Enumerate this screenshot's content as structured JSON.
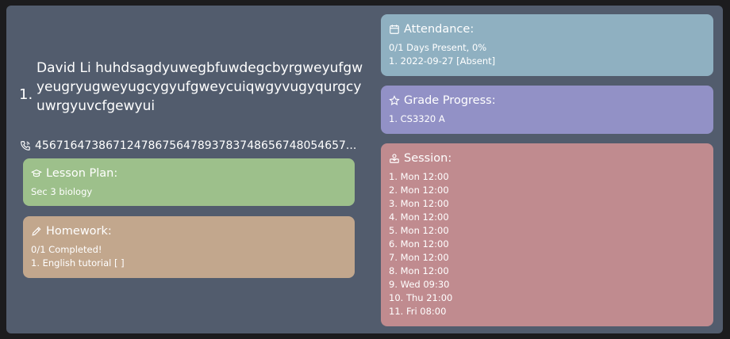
{
  "student": {
    "index": "1.",
    "name": "David Li huhdsagdyuwegbfuwdegcbyrgweyufgwyeugryugweyugcygyufgweycuiqwgyvugyqurgcyuwrgyuvcfgewyui",
    "phone": "45671647386712478675647893783748656748054657...",
    "phone_icon": "phone-icon"
  },
  "lesson_plan": {
    "title": "Lesson Plan:",
    "icon": "graduation-cap-icon",
    "lines": [
      "Sec 3 biology"
    ]
  },
  "homework": {
    "title": "Homework:",
    "icon": "pencil-icon",
    "lines": [
      "0/1 Completed!",
      "1. English tutorial [ ]"
    ]
  },
  "attendance": {
    "title": "Attendance:",
    "icon": "calendar-icon",
    "lines": [
      "0/1 Days Present, 0%",
      "1. 2022-09-27 [Absent]"
    ]
  },
  "grade_progress": {
    "title": "Grade Progress:",
    "icon": "star-icon",
    "lines": [
      "1. CS3320 A"
    ]
  },
  "session": {
    "title": "Session:",
    "icon": "teacher-icon",
    "lines": [
      "1. Mon 12:00",
      "2. Mon 12:00",
      "3. Mon 12:00",
      "4. Mon 12:00",
      "5. Mon 12:00",
      "6. Mon 12:00",
      "7. Mon 12:00",
      "8. Mon 12:00",
      "9. Wed 09:30",
      "10. Thu 21:00",
      "11. Fri 08:00"
    ]
  },
  "colors": {
    "card_bg": "#525c6d",
    "lesson_plan_bg": "#9dc08b",
    "homework_bg": "#c2a78d",
    "attendance_bg": "#8fb0c1",
    "grade_progress_bg": "#9291c6",
    "session_bg": "#c08b8f"
  }
}
